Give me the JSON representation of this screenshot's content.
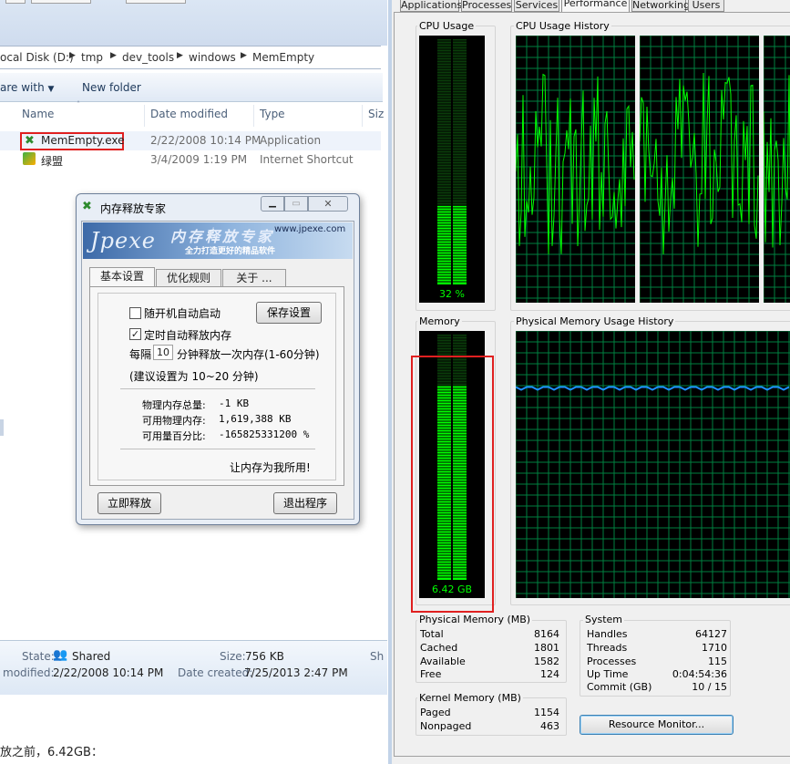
{
  "explorer": {
    "breadcrumb": [
      "ocal Disk (D:)",
      "tmp",
      "dev_tools",
      "windows",
      "MemEmpty"
    ],
    "commands": {
      "share": "are with",
      "new_folder": "New folder"
    },
    "columns": [
      "Name",
      "Date modified",
      "Type",
      "Siz"
    ],
    "files": [
      {
        "name": "MemEmpty.exe",
        "date": "2/22/2008 10:14 PM",
        "type": "Application"
      },
      {
        "name": "绿盟",
        "date": "3/4/2009 1:19 PM",
        "type": "Internet Shortcut"
      }
    ],
    "details": {
      "state_label": "State:",
      "state_value": "Shared",
      "size_label": "Size:",
      "size_value": "756 KB",
      "modified_label": "modified:",
      "modified_value": "2/22/2008 10:14 PM",
      "created_label": "Date created:",
      "created_value": "7/25/2013 2:47 PM",
      "cut_label": "Sh"
    },
    "caption": "放之前，6.42GB："
  },
  "dialog": {
    "title": "内存释放专家",
    "banner_title": "内存释放专家",
    "banner_url": "www.jpexe.com",
    "banner_sub": "全力打造更好的精品软件",
    "banner_logo": "Jpexe",
    "tabs": [
      "基本设置",
      "优化规则",
      "关于 ..."
    ],
    "autostart": "随开机自动启动",
    "save": "保存设置",
    "timed_release": "定时自动释放内存",
    "every": "每隔",
    "interval": "10",
    "interval_suffix": "分钟释放一次内存(1-60分钟)",
    "suggest": "(建议设置为 10~20 分钟)",
    "total_label": "物理内存总量:",
    "total_value": "-1 KB",
    "avail_label": "可用物理内存:",
    "avail_value": "1,619,388 KB",
    "pct_label": "可用量百分比:",
    "pct_value": "-165825331200 %",
    "slogan": "让内存为我所用!",
    "release_now": "立即释放",
    "exit": "退出程序"
  },
  "taskmgr": {
    "tabs": [
      "Applications",
      "Processes",
      "Services",
      "Performance",
      "Networking",
      "Users"
    ],
    "active_tab": "Performance",
    "cpu_usage_label": "CPU Usage",
    "cpu_history_label": "CPU Usage History",
    "cpu_percent": "32 %",
    "cpu_fraction": 0.32,
    "memory_label": "Memory",
    "memory_history_label": "Physical Memory Usage History",
    "memory_value": "6.42 GB",
    "memory_fraction": 0.79,
    "physical_memory": {
      "title": "Physical Memory (MB)",
      "rows": [
        {
          "label": "Total",
          "value": "8164"
        },
        {
          "label": "Cached",
          "value": "1801"
        },
        {
          "label": "Available",
          "value": "1582"
        },
        {
          "label": "Free",
          "value": "124"
        }
      ]
    },
    "kernel_memory": {
      "title": "Kernel Memory (MB)",
      "rows": [
        {
          "label": "Paged",
          "value": "1154"
        },
        {
          "label": "Nonpaged",
          "value": "463"
        }
      ]
    },
    "system": {
      "title": "System",
      "rows": [
        {
          "label": "Handles",
          "value": "64127"
        },
        {
          "label": "Threads",
          "value": "1710"
        },
        {
          "label": "Processes",
          "value": "115"
        },
        {
          "label": "Up Time",
          "value": "0:04:54:36"
        },
        {
          "label": "Commit (GB)",
          "value": "10 / 15"
        }
      ]
    },
    "resource_monitor": "Resource Monitor...",
    "colors": {
      "graph_green": "#00ff00",
      "grid_green": "#008040",
      "history_blue": "#1e90ff",
      "highlight_red": "#e02020"
    }
  }
}
